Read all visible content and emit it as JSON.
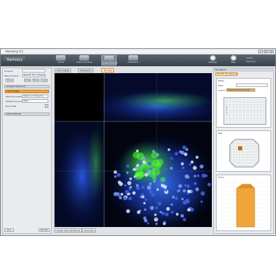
{
  "window": {
    "title": "Harmony 4.1"
  },
  "toolbar": {
    "logo": "Harmony",
    "buttons": [
      {
        "label": "Home"
      },
      {
        "label": "Plate Overview"
      },
      {
        "label": "Image Analysis"
      },
      {
        "label": "Evaluation"
      }
    ],
    "right_buttons": [
      {
        "label": "Settings"
      },
      {
        "label": "Help"
      }
    ],
    "status_lines": [
      "admin",
      "Harmony"
    ]
  },
  "left": {
    "analysis_label": "Analysis",
    "measurement_label": "Measurement",
    "measurement_value": "NUCLEI_3D_s_Measure",
    "buttons": [
      "Show",
      "Close",
      "Save",
      "Load"
    ],
    "section_title": "Analysis Sequence",
    "steps": [
      {
        "label": "Input Image",
        "value": "",
        "selected": true
      },
      {
        "label": "Stack Processing",
        "value": "Maximum Projectio",
        "selected": false
      },
      {
        "label": "Flatfield Correction",
        "value": "Basic",
        "selected": false
      },
      {
        "label": "Build Tuffs",
        "value": "",
        "selected": false
      }
    ],
    "define_results": "Define Results",
    "footer_left": "Run",
    "footer_right": "Results"
  },
  "viewer": {
    "tabs": [
      "Input Image",
      "Histogram",
      "3D View"
    ],
    "active_tab_index": 2,
    "bottom_buttons": [
      "Image View (3D Mode)",
      "Overview"
    ],
    "colors": {
      "nuclei": "#2f6bff",
      "gfp": "#37ff2a",
      "background": "#000000"
    }
  },
  "right": {
    "header": "Navigation",
    "tab": "NUCLEI_3D_Measure",
    "plate_card_title": "Plates",
    "plate_label": "Plate",
    "layout_label": "Layout",
    "layout_value": "Measurement Layout",
    "well_card_title": "Well",
    "stack_card_title": "Stack",
    "accent": "#f0a53a"
  }
}
